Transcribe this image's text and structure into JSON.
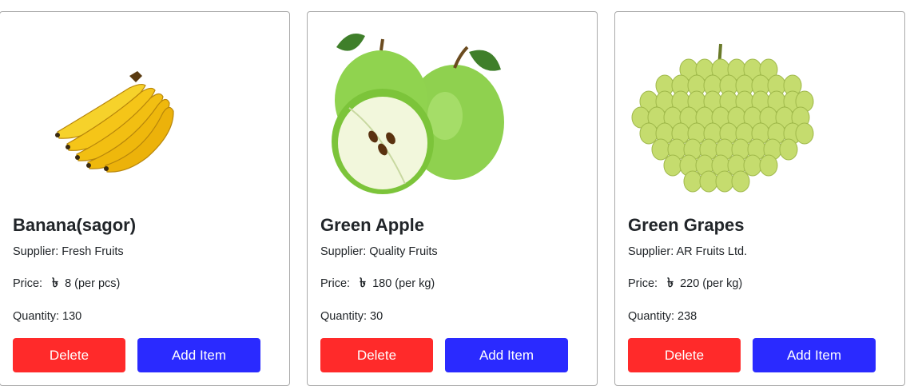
{
  "products": [
    {
      "name": "Banana(sagor)",
      "supplier": "Supplier: Fresh Fruits",
      "price_label": "Price:",
      "currency_symbol": "৳",
      "price": "8 (per pcs)",
      "quantity": "Quantity: 130",
      "delete_label": "Delete",
      "add_label": "Add Item",
      "image": "banana-image"
    },
    {
      "name": "Green Apple",
      "supplier": "Supplier: Quality Fruits",
      "price_label": "Price:",
      "currency_symbol": "৳",
      "price": "180 (per kg)",
      "quantity": "Quantity: 30",
      "delete_label": "Delete",
      "add_label": "Add Item",
      "image": "green-apple-image"
    },
    {
      "name": "Green Grapes",
      "supplier": "Supplier: AR Fruits Ltd.",
      "price_label": "Price:",
      "currency_symbol": "৳",
      "price": "220 (per kg)",
      "quantity": "Quantity: 238",
      "delete_label": "Delete",
      "add_label": "Add Item",
      "image": "green-grapes-image"
    }
  ],
  "colors": {
    "delete": "#ff2a2a",
    "add": "#2a2aff",
    "banana": "#f5c518",
    "apple": "#8fd14f",
    "grape": "#c5dc6e"
  }
}
